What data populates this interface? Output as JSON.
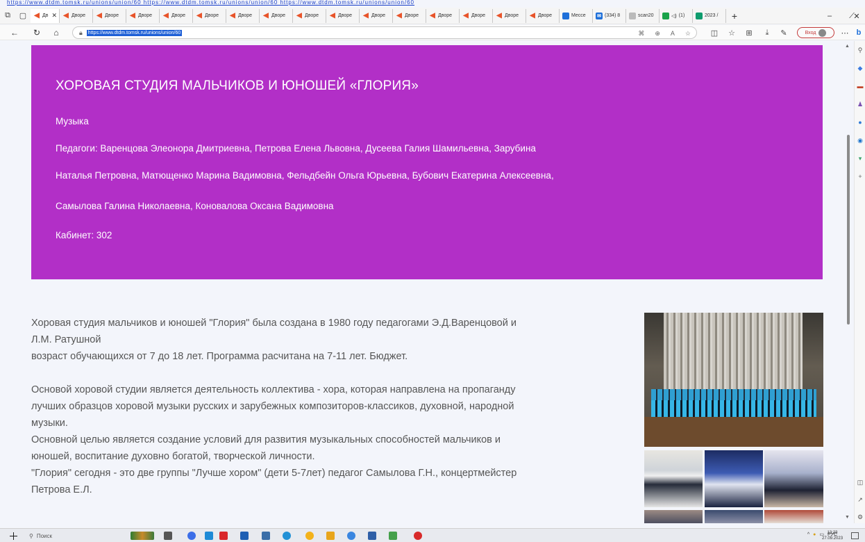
{
  "browser": {
    "top_url_line": "https://www.dtdm.tomsk.ru/unions/union/60 https://www.dtdm.tomsk.ru/unions/union/60 https://www.dtdm.tomsk.ru/unions/union/60",
    "active_tab_label": "Дв",
    "tabs": [
      "Дворе",
      "Дворе",
      "Дворе",
      "Дворе",
      "Дворе",
      "Дворе",
      "Дворе",
      "Дворе",
      "Дворе",
      "Дворе",
      "Дворе",
      "Дворе",
      "Дворе",
      "Дворе",
      "Дворе"
    ],
    "extra_tabs": [
      {
        "label": "Мессе",
        "color": "#1e6fd9"
      },
      {
        "label": "(334) 8",
        "color": "#1e6fd9"
      },
      {
        "label": "scan20",
        "color": "#bbbbbb"
      },
      {
        "label": "(1)",
        "color": "#1aa34a"
      },
      {
        "label": "2023 /",
        "color": "#0f9c6e"
      }
    ],
    "url": "https://www.dtdm.tomsk.ru/unions/union/60",
    "signin_label": "Вход"
  },
  "hero": {
    "title": "ХОРОВАЯ СТУДИЯ МАЛЬЧИКОВ И ЮНОШЕЙ «ГЛОРИЯ»",
    "category": "Музыка",
    "teachers_line1": "Педагоги: Варенцова Элеонора Дмитриевна, Петрова Елена Львовна, Дусеева Галия Шамильевна, Зарубина",
    "teachers_line2": "Наталья Петровна, Матющенко Марина Вадимовна, Фельдбейн Ольга Юрьевна, Бубович Екатерина Алексеевна,",
    "teachers_line3": "Самылова Галина Николаевна, Коновалова Оксана Вадимовна",
    "room": "Кабинет: 302",
    "bg_color": "#b22fc7"
  },
  "body": {
    "l1": "Хоровая студия мальчиков и юношей \"Глория\" была создана в 1980 году педагогами  Э.Д.Варенцовой и",
    "l2": "Л.М. Ратушной",
    "l3": "возраст обучающихся от 7 до 18 лет. Программа расчитана на 7-11 лет. Бюджет.",
    "l4": "Основой хоровой студии является деятельность коллектива - хора, которая направлена на пропаганду",
    "l5": "лучших образцов хоровой музыки русских и зарубежных композиторов-классиков, духовной, народной",
    "l6": "музыки.",
    "l7": "Основной целью является создание условий для развития музыкальных способностей мальчиков и",
    "l8": "юношей, воспитание духовно богатой, творческой личности.",
    "l9": "\"Глория\" сегодня - это две группы \"Лучше хором\" (дети 5-7лет) педагог Самылова Г.Н., концертмейстер",
    "l10": "Петрова Е.Л."
  },
  "taskbar": {
    "search_label": "Поиск",
    "lang": "РУС",
    "time": "13:23",
    "date": "27.09.2023"
  }
}
